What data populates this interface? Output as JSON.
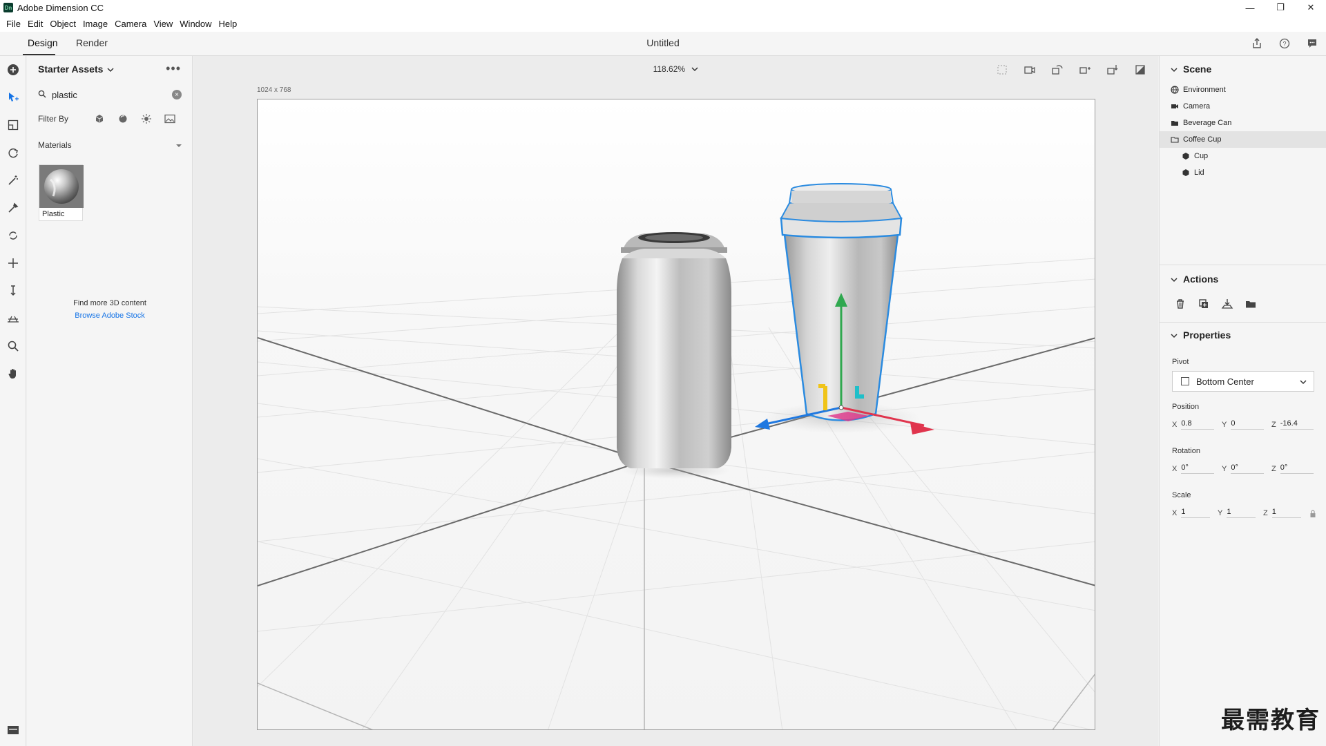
{
  "window": {
    "app_title": "Adobe Dimension CC",
    "logo_text": "Dn",
    "minimize": "—",
    "restore": "❐",
    "close": "✕"
  },
  "menu": [
    "File",
    "Edit",
    "Object",
    "Image",
    "Camera",
    "View",
    "Window",
    "Help"
  ],
  "modes": {
    "design": "Design",
    "render": "Render"
  },
  "document": {
    "title": "Untitled"
  },
  "assets": {
    "header": "Starter Assets",
    "more": "•••",
    "search_value": "plastic",
    "filter_label": "Filter By",
    "category": "Materials",
    "material_name": "Plastic",
    "find_more": "Find more 3D content",
    "browse_link": "Browse Adobe Stock"
  },
  "viewport": {
    "zoom": "118.62%",
    "canvas_size": "1024 x 768"
  },
  "scene": {
    "title": "Scene",
    "items": [
      {
        "label": "Environment",
        "icon": "environment-icon"
      },
      {
        "label": "Camera",
        "icon": "camera-icon"
      },
      {
        "label": "Beverage Can",
        "icon": "folder-icon"
      },
      {
        "label": "Coffee Cup",
        "icon": "folder-open-icon"
      },
      {
        "label": "Cup",
        "icon": "mesh-icon"
      },
      {
        "label": "Lid",
        "icon": "mesh-icon"
      }
    ]
  },
  "actions": {
    "title": "Actions"
  },
  "properties": {
    "title": "Properties",
    "pivot_label": "Pivot",
    "pivot_value": "Bottom Center",
    "position_label": "Position",
    "position": {
      "x": "0.8",
      "y": "0",
      "z": "-16.4"
    },
    "rotation_label": "Rotation",
    "rotation": {
      "x": "0°",
      "y": "0°",
      "z": "0°"
    },
    "scale_label": "Scale",
    "scale": {
      "x": "1",
      "y": "1",
      "z": "1"
    }
  },
  "watermark": "最需教育",
  "colors": {
    "accent": "#1473e6",
    "selection_outline": "#2b8be0",
    "gizmo_y": "#2fa84f",
    "gizmo_x": "#e0344d",
    "gizmo_z": "#1f78e0"
  }
}
